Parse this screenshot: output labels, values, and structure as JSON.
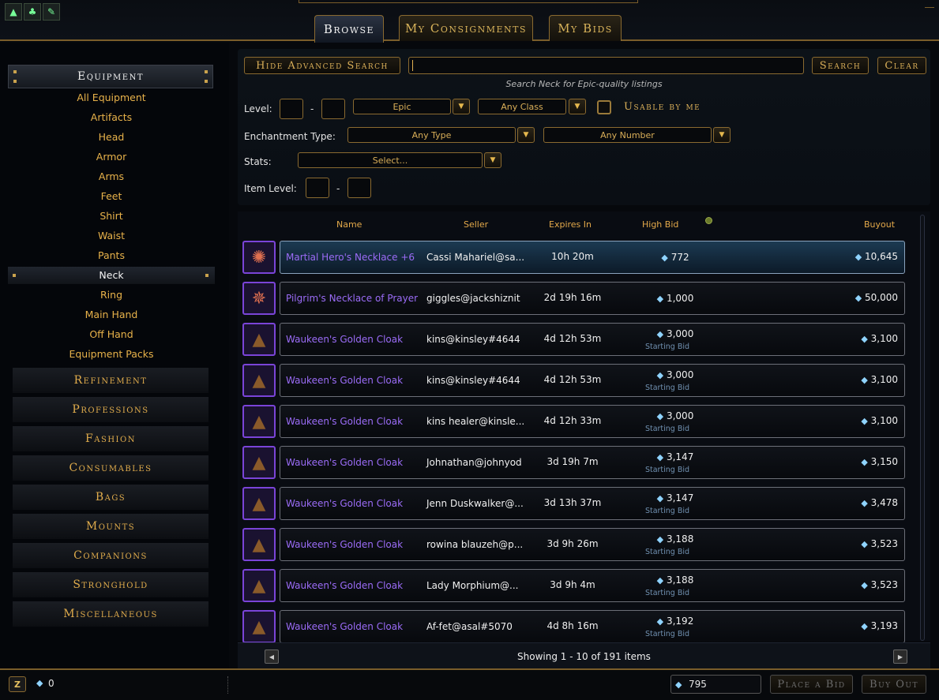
{
  "tabs": [
    {
      "label": "Browse",
      "active": true
    },
    {
      "label": "My Consignments",
      "active": false
    },
    {
      "label": "My Bids",
      "active": false
    }
  ],
  "sidebar": {
    "equipment": "Equipment",
    "equipment_items": [
      "All Equipment",
      "Artifacts",
      "Head",
      "Armor",
      "Arms",
      "Feet",
      "Shirt",
      "Waist",
      "Pants",
      "Neck",
      "Ring",
      "Main Hand",
      "Off Hand",
      "Equipment Packs"
    ],
    "selected_item": "Neck",
    "categories": [
      "Refinement",
      "Professions",
      "Fashion",
      "Consumables",
      "Bags",
      "Mounts",
      "Companions",
      "Stronghold",
      "Miscellaneous"
    ]
  },
  "search": {
    "hide_advanced_label": "Hide Advanced Search",
    "search_label": "Search",
    "clear_label": "Clear",
    "input_value": "",
    "hint": "Search Neck for Epic-quality listings",
    "level_label": "Level:",
    "level_sep": "-",
    "quality": "Epic",
    "class": "Any Class",
    "usable_label": "Usable by me",
    "enchant_label": "Enchantment Type:",
    "enchant_type": "Any Type",
    "enchant_number": "Any Number",
    "stats_label": "Stats:",
    "stats_value": "Select...",
    "item_level_label": "Item Level:",
    "item_level_sep": "-"
  },
  "columns": {
    "name": "Name",
    "seller": "Seller",
    "expires": "Expires In",
    "high_bid": "High Bid",
    "buyout": "Buyout"
  },
  "rows": [
    {
      "name": "Martial Hero's Necklace +6",
      "seller": "Cassi Mahariel@sa...",
      "expires": "10h 20m",
      "bid": "772",
      "bid_sub": "",
      "buyout": "10,645",
      "icon": "necklace-icon",
      "glyph": "✺",
      "selected": true
    },
    {
      "name": "Pilgrim's Necklace of Prayer",
      "seller": "giggles@jackshiznit",
      "expires": "2d 19h 16m",
      "bid": "1,000",
      "bid_sub": "",
      "buyout": "50,000",
      "icon": "necklace-icon",
      "glyph": "✵",
      "selected": false
    },
    {
      "name": "Waukeen's Golden Cloak",
      "seller": "kins@kinsley#4644",
      "expires": "4d 12h 53m",
      "bid": "3,000",
      "bid_sub": "Starting Bid",
      "buyout": "3,100",
      "icon": "cloak-icon",
      "glyph": "▲",
      "selected": false
    },
    {
      "name": "Waukeen's Golden Cloak",
      "seller": "kins@kinsley#4644",
      "expires": "4d 12h 53m",
      "bid": "3,000",
      "bid_sub": "Starting Bid",
      "buyout": "3,100",
      "icon": "cloak-icon",
      "glyph": "▲",
      "selected": false
    },
    {
      "name": "Waukeen's Golden Cloak",
      "seller": "kins healer@kinsle...",
      "expires": "4d 12h 33m",
      "bid": "3,000",
      "bid_sub": "Starting Bid",
      "buyout": "3,100",
      "icon": "cloak-icon",
      "glyph": "▲",
      "selected": false
    },
    {
      "name": "Waukeen's Golden Cloak",
      "seller": "Johnathan@johnyod",
      "expires": "3d 19h 7m",
      "bid": "3,147",
      "bid_sub": "Starting Bid",
      "buyout": "3,150",
      "icon": "cloak-icon",
      "glyph": "▲",
      "selected": false
    },
    {
      "name": "Waukeen's Golden Cloak",
      "seller": "Jenn Duskwalker@...",
      "expires": "3d 13h 37m",
      "bid": "3,147",
      "bid_sub": "Starting Bid",
      "buyout": "3,478",
      "icon": "cloak-icon",
      "glyph": "▲",
      "selected": false
    },
    {
      "name": "Waukeen's Golden Cloak",
      "seller": "rowina blauzeh@p...",
      "expires": "3d 9h 26m",
      "bid": "3,188",
      "bid_sub": "Starting Bid",
      "buyout": "3,523",
      "icon": "cloak-icon",
      "glyph": "▲",
      "selected": false
    },
    {
      "name": "Waukeen's Golden Cloak",
      "seller": "Lady Morphium@...",
      "expires": "3d 9h 4m",
      "bid": "3,188",
      "bid_sub": "Starting Bid",
      "buyout": "3,523",
      "icon": "cloak-icon",
      "glyph": "▲",
      "selected": false
    },
    {
      "name": "Waukeen's Golden Cloak",
      "seller": "Af-fet@asal#5070",
      "expires": "4d 8h 16m",
      "bid": "3,192",
      "bid_sub": "Starting Bid",
      "buyout": "3,193",
      "icon": "cloak-icon",
      "glyph": "▲",
      "selected": false
    }
  ],
  "pager": {
    "text": "Showing 1 - 10 of 191 items"
  },
  "bottom": {
    "zen_icon_label": "Z",
    "currency_amount": "0",
    "bid_amount": "795",
    "place_bid_label": "Place a Bid",
    "buy_out_label": "Buy Out"
  },
  "colors": {
    "gold": "#d9ae58",
    "epic": "#9b6cf7",
    "astral": "#8fd3ff"
  }
}
